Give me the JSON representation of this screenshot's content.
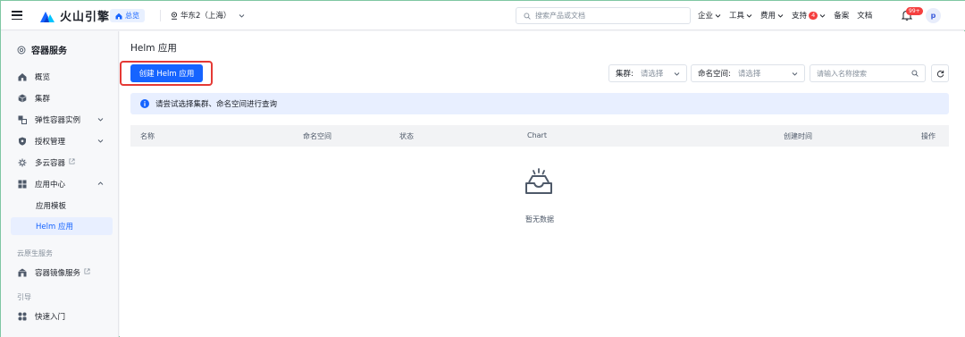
{
  "topbar": {
    "brand": "火山引擎",
    "home_tag": "总览",
    "region": "华东2（上海）",
    "search_placeholder": "搜索产品或文档",
    "nav": [
      {
        "label": "企业",
        "has_menu": true
      },
      {
        "label": "工具",
        "has_menu": true
      },
      {
        "label": "费用",
        "has_menu": true
      },
      {
        "label": "支持",
        "has_menu": true,
        "badge": "4"
      },
      {
        "label": "备案",
        "has_menu": false
      },
      {
        "label": "文档",
        "has_menu": false
      }
    ],
    "notification_badge": "99+",
    "avatar_initial": "p"
  },
  "sidebar": {
    "title": "容器服务",
    "items": [
      {
        "label": "概览",
        "icon": "home-icon"
      },
      {
        "label": "集群",
        "icon": "cube-icon"
      },
      {
        "label": "弹性容器实例",
        "icon": "elastic-icon",
        "expandable": true
      },
      {
        "label": "授权管理",
        "icon": "shield-icon",
        "expandable": true
      },
      {
        "label": "多云容器",
        "icon": "multicloud-icon",
        "external": true
      },
      {
        "label": "应用中心",
        "icon": "apps-icon",
        "expanded": true
      },
      {
        "label": "应用模板",
        "sub": true
      },
      {
        "label": "Helm 应用",
        "sub": true,
        "active": true
      }
    ],
    "section_cloud_native": "云原生服务",
    "registry_label": "容器镜像服务",
    "section_guide": "引导",
    "quickstart_label": "快速入门"
  },
  "main": {
    "page_title": "Helm 应用",
    "create_button": "创建 Helm 应用",
    "filter_cluster_label": "集群:",
    "filter_cluster_placeholder": "请选择",
    "filter_namespace_label": "命名空间:",
    "filter_namespace_placeholder": "请选择",
    "search_placeholder": "请输入名称搜索",
    "info_text": "请尝试选择集群、命名空间进行查询",
    "columns": [
      "名称",
      "命名空间",
      "状态",
      "Chart",
      "创建时间",
      "操作"
    ],
    "empty_text": "暂无数据"
  },
  "colors": {
    "primary": "#1664ff",
    "highlight_border": "#e53935",
    "badge": "#f53f3f",
    "info_bg": "#e8efff"
  }
}
